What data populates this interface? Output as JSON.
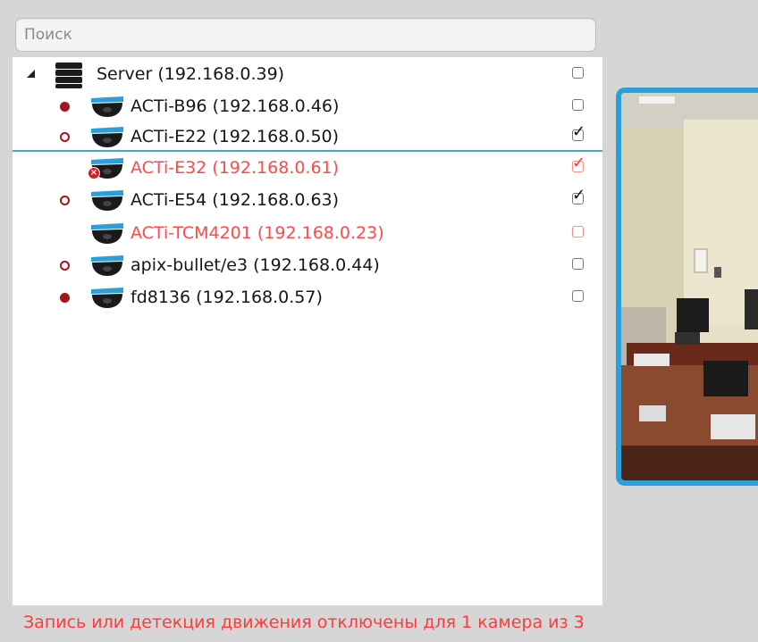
{
  "search": {
    "placeholder": "Поиск",
    "value": ""
  },
  "tree": {
    "server": {
      "label": "Server (192.168.0.39)",
      "checked": false
    },
    "cameras": [
      {
        "label": "ACTi-B96 (192.168.0.46)",
        "status": "recording",
        "error": false,
        "checked": false
      },
      {
        "label": "ACTi-E22 (192.168.0.50)",
        "status": "idle",
        "error": false,
        "checked": true
      },
      {
        "label": "ACTi-E32 (192.168.0.61)",
        "status": "none",
        "error": true,
        "checked": true
      },
      {
        "label": "ACTi-E54 (192.168.0.63)",
        "status": "idle",
        "error": false,
        "checked": true
      },
      {
        "label": "ACTi-TCM4201 (192.168.0.23)",
        "status": "none",
        "error": true,
        "checked": false
      },
      {
        "label": "apix-bullet/e3 (192.168.0.44)",
        "status": "idle",
        "error": false,
        "checked": false
      },
      {
        "label": "fd8136 (192.168.0.57)",
        "status": "recording",
        "error": false,
        "checked": false
      }
    ]
  },
  "status_message": "Запись или детекция движения отключены для 1 камера из 3",
  "icons": {
    "expander": "triangle-expanded-icon",
    "server": "server-stack-icon",
    "camera": "dome-camera-icon",
    "camera_error": "camera-error-icon",
    "checkmark": "✓"
  },
  "colors": {
    "accent": "#2a9fd8",
    "error_text": "#ff4a4a",
    "recording_dot": "#a3141c",
    "selection_line": "#3fa7d6"
  }
}
